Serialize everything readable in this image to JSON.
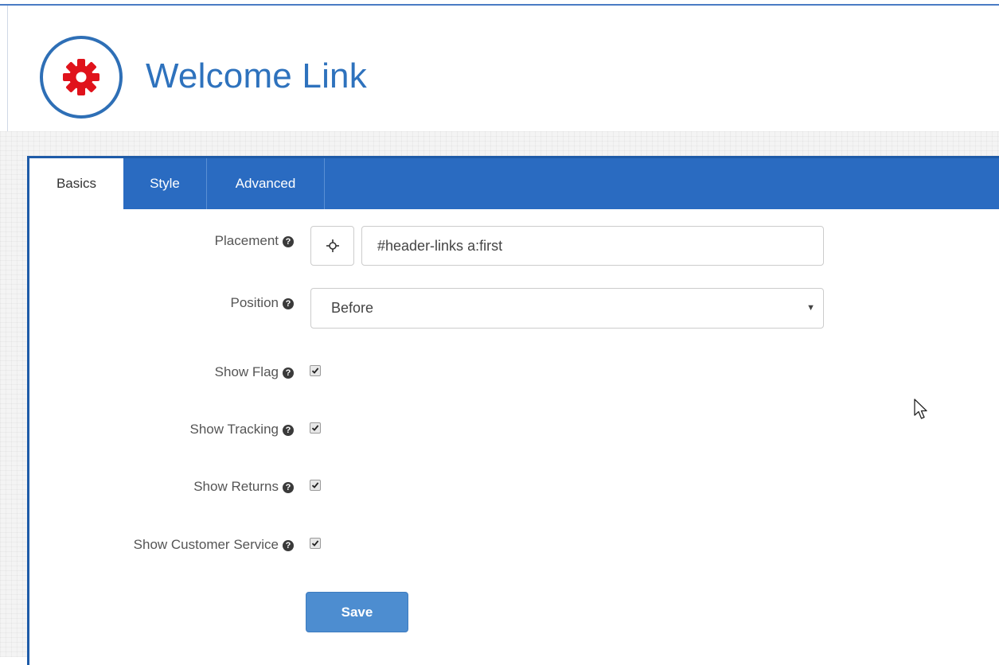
{
  "header": {
    "title": "Welcome Link",
    "logo_icon": "gear-icon",
    "logo_color": "#e0121b",
    "accent_color": "#2e72bd"
  },
  "tabs": [
    {
      "label": "Basics",
      "active": true
    },
    {
      "label": "Style",
      "active": false
    },
    {
      "label": "Advanced",
      "active": false
    }
  ],
  "form": {
    "placement": {
      "label": "Placement",
      "picker_icon": "crosshair-icon",
      "value": "#header-links a:first"
    },
    "position": {
      "label": "Position",
      "selected": "Before"
    },
    "show_flag": {
      "label": "Show Flag",
      "checked": true
    },
    "show_tracking": {
      "label": "Show Tracking",
      "checked": true
    },
    "show_returns": {
      "label": "Show Returns",
      "checked": true
    },
    "show_customer_service": {
      "label": "Show Customer Service",
      "checked": true
    },
    "help_icon": "question-circle-icon"
  },
  "actions": {
    "save_label": "Save"
  },
  "colors": {
    "tabbar": "#2a6bc1",
    "save_button": "#4d8dd0"
  }
}
